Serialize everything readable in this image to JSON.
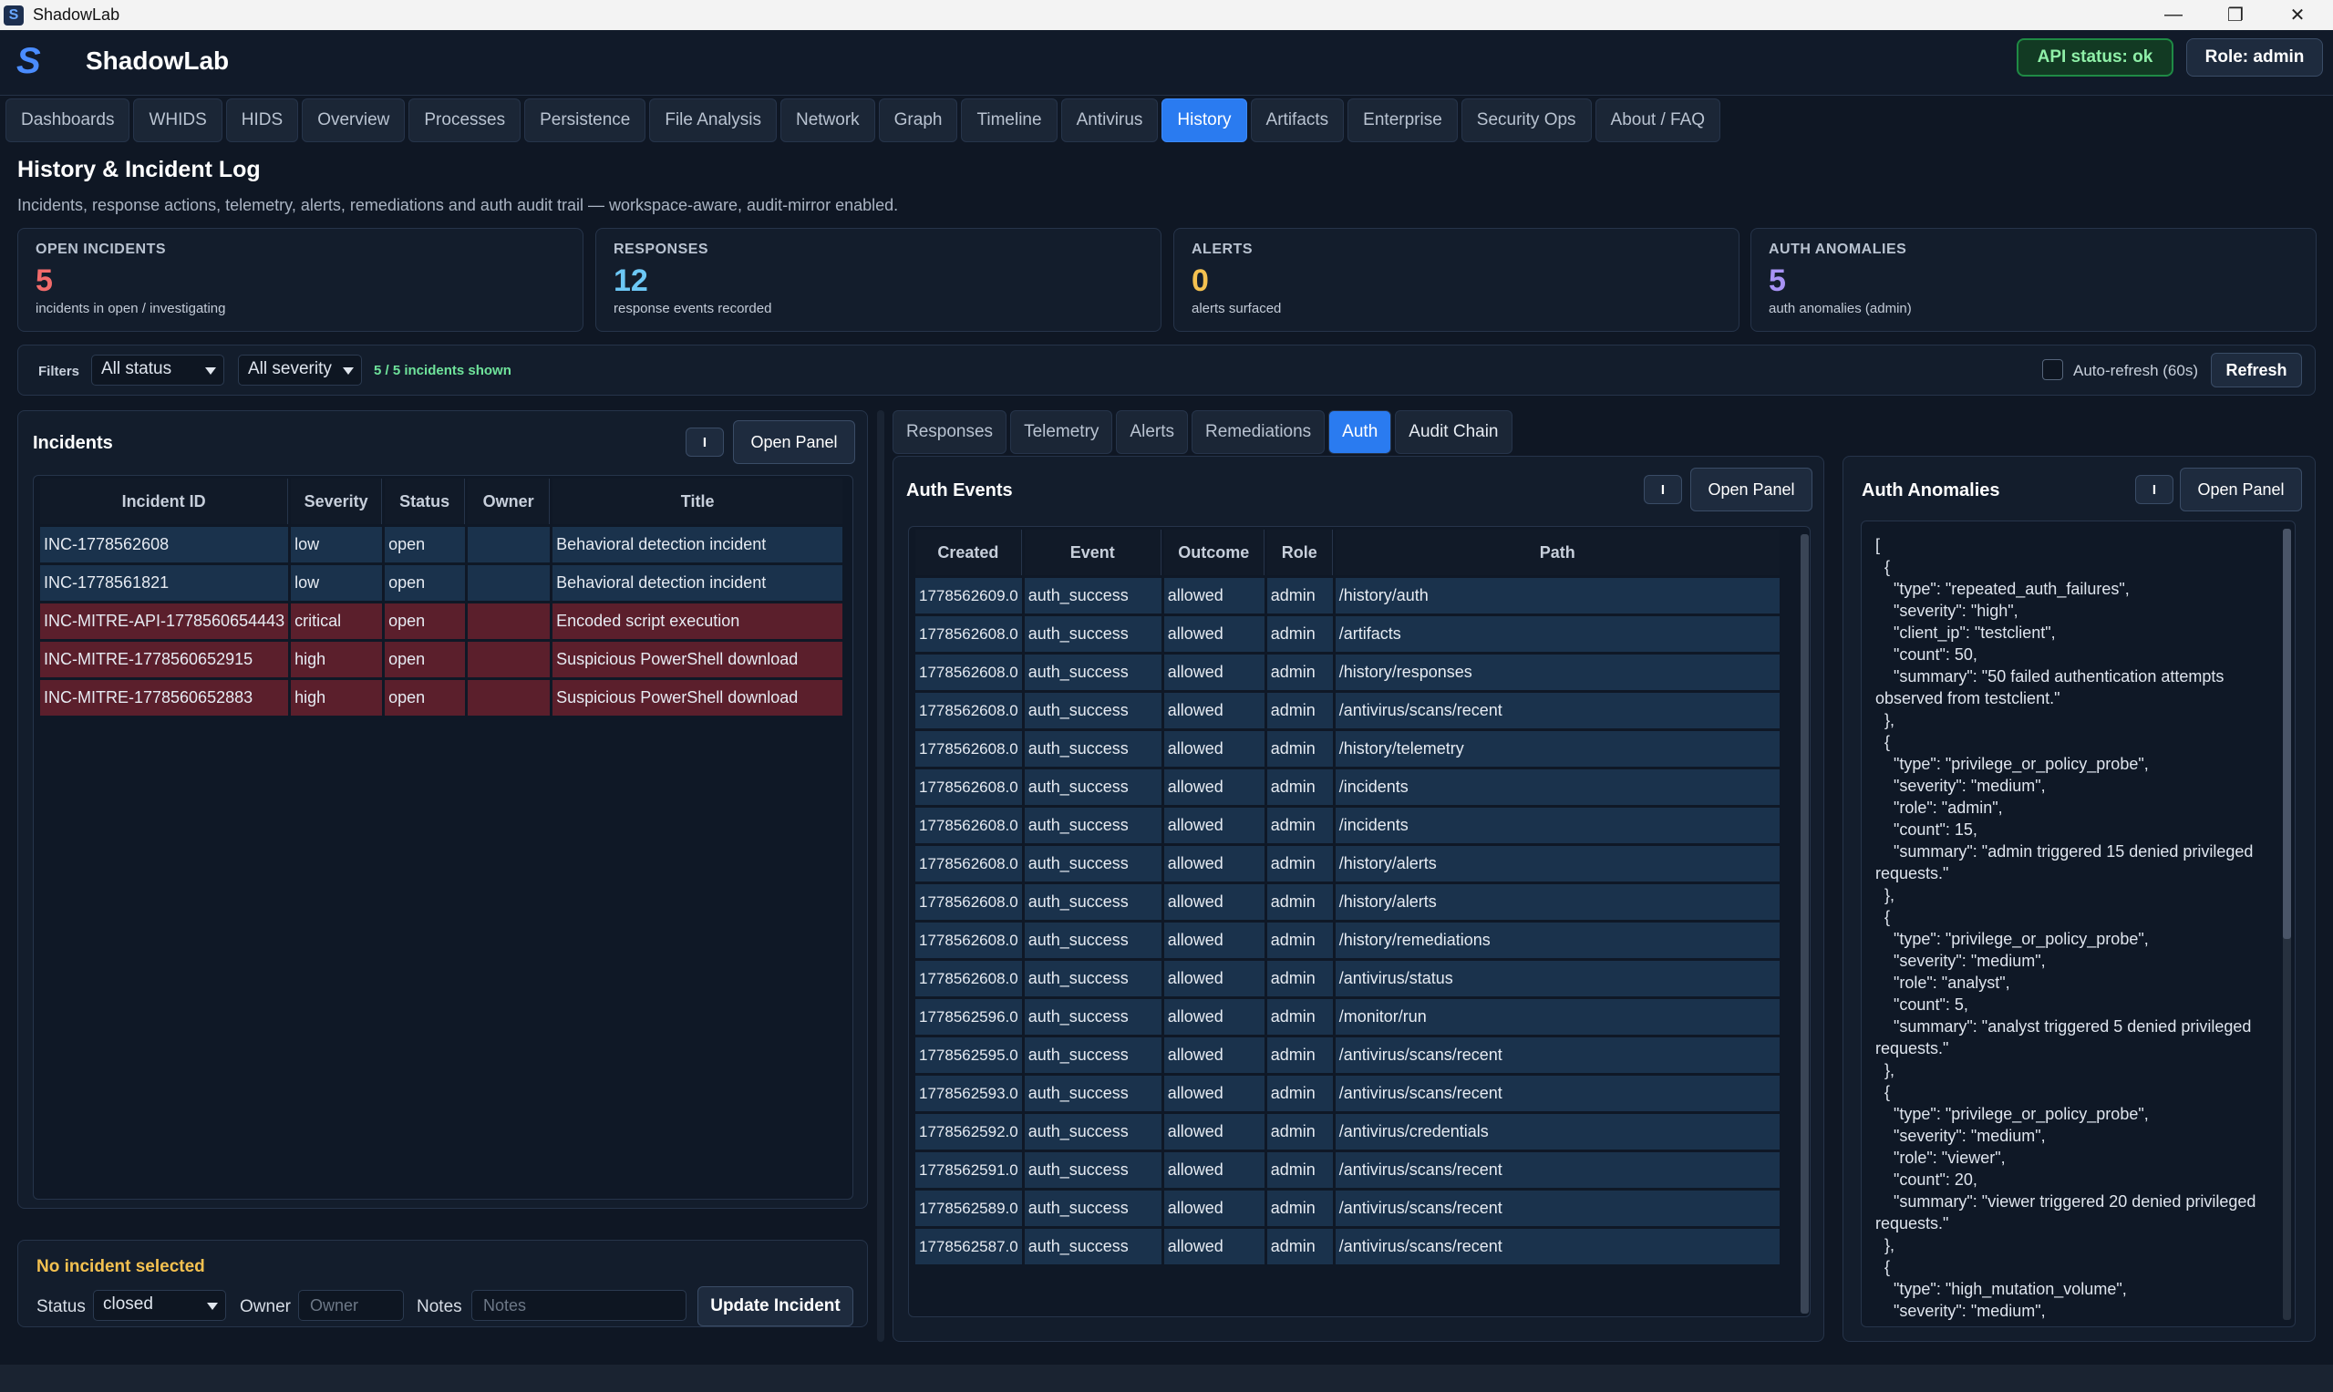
{
  "window": {
    "title": "ShadowLab"
  },
  "header": {
    "logo": "S",
    "brand": "ShadowLab",
    "api_status": "API status: ok",
    "role": "Role: admin"
  },
  "nav": {
    "tabs": [
      "Dashboards",
      "WHIDS",
      "HIDS",
      "Overview",
      "Processes",
      "Persistence",
      "File Analysis",
      "Network",
      "Graph",
      "Timeline",
      "Antivirus",
      "History",
      "Artifacts",
      "Enterprise",
      "Security Ops",
      "About / FAQ"
    ],
    "active": "History"
  },
  "page": {
    "title": "History & Incident Log",
    "subtitle": "Incidents, response actions, telemetry, alerts, remediations and auth audit trail — workspace-aware, audit-mirror enabled."
  },
  "stats": [
    {
      "label": "OPEN INCIDENTS",
      "value": "5",
      "desc": "incidents in open / investigating",
      "color": "#f26b6b"
    },
    {
      "label": "RESPONSES",
      "value": "12",
      "desc": "response events recorded",
      "color": "#6cc7f5"
    },
    {
      "label": "ALERTS",
      "value": "0",
      "desc": "alerts surfaced",
      "color": "#f4c150"
    },
    {
      "label": "AUTH ANOMALIES",
      "value": "5",
      "desc": "auth anomalies (admin)",
      "color": "#a893f5"
    }
  ],
  "filters": {
    "label": "Filters",
    "status": "All status",
    "severity": "All severity",
    "count": "5 / 5 incidents shown",
    "auto_refresh": "Auto-refresh (60s)",
    "refresh": "Refresh"
  },
  "incidents": {
    "title": "Incidents",
    "info_btn": "I",
    "open_panel": "Open Panel",
    "columns": [
      "Incident ID",
      "Severity",
      "Status",
      "Owner",
      "Title"
    ],
    "rows": [
      {
        "id": "INC-1778562608",
        "severity": "low",
        "status": "open",
        "owner": "",
        "title": "Behavioral detection incident",
        "hot": false
      },
      {
        "id": "INC-1778561821",
        "severity": "low",
        "status": "open",
        "owner": "",
        "title": "Behavioral detection incident",
        "hot": false
      },
      {
        "id": "INC-MITRE-API-1778560654443",
        "severity": "critical",
        "status": "open",
        "owner": "",
        "title": "Encoded script execution",
        "hot": true
      },
      {
        "id": "INC-MITRE-1778560652915",
        "severity": "high",
        "status": "open",
        "owner": "",
        "title": "Suspicious PowerShell download",
        "hot": true
      },
      {
        "id": "INC-MITRE-1778560652883",
        "severity": "high",
        "status": "open",
        "owner": "",
        "title": "Suspicious PowerShell download",
        "hot": true
      }
    ]
  },
  "incident_editor": {
    "none_selected": "No incident selected",
    "status_label": "Status",
    "status_value": "closed",
    "owner_label": "Owner",
    "owner_placeholder": "Owner",
    "notes_label": "Notes",
    "notes_placeholder": "Notes",
    "update": "Update Incident"
  },
  "subtabs": {
    "items": [
      "Responses",
      "Telemetry",
      "Alerts",
      "Remediations",
      "Auth",
      "Audit Chain"
    ],
    "active": "Auth"
  },
  "auth_events": {
    "title": "Auth Events",
    "info_btn": "I",
    "open_panel": "Open Panel",
    "columns": [
      "Created",
      "Event",
      "Outcome",
      "Role",
      "Path"
    ],
    "rows": [
      [
        "1778562609.0",
        "auth_success",
        "allowed",
        "admin",
        "/history/auth"
      ],
      [
        "1778562608.0",
        "auth_success",
        "allowed",
        "admin",
        "/artifacts"
      ],
      [
        "1778562608.0",
        "auth_success",
        "allowed",
        "admin",
        "/history/responses"
      ],
      [
        "1778562608.0",
        "auth_success",
        "allowed",
        "admin",
        "/antivirus/scans/recent"
      ],
      [
        "1778562608.0",
        "auth_success",
        "allowed",
        "admin",
        "/history/telemetry"
      ],
      [
        "1778562608.0",
        "auth_success",
        "allowed",
        "admin",
        "/incidents"
      ],
      [
        "1778562608.0",
        "auth_success",
        "allowed",
        "admin",
        "/incidents"
      ],
      [
        "1778562608.0",
        "auth_success",
        "allowed",
        "admin",
        "/history/alerts"
      ],
      [
        "1778562608.0",
        "auth_success",
        "allowed",
        "admin",
        "/history/alerts"
      ],
      [
        "1778562608.0",
        "auth_success",
        "allowed",
        "admin",
        "/history/remediations"
      ],
      [
        "1778562608.0",
        "auth_success",
        "allowed",
        "admin",
        "/antivirus/status"
      ],
      [
        "1778562596.0",
        "auth_success",
        "allowed",
        "admin",
        "/monitor/run"
      ],
      [
        "1778562595.0",
        "auth_success",
        "allowed",
        "admin",
        "/antivirus/scans/recent"
      ],
      [
        "1778562593.0",
        "auth_success",
        "allowed",
        "admin",
        "/antivirus/scans/recent"
      ],
      [
        "1778562592.0",
        "auth_success",
        "allowed",
        "admin",
        "/antivirus/credentials"
      ],
      [
        "1778562591.0",
        "auth_success",
        "allowed",
        "admin",
        "/antivirus/scans/recent"
      ],
      [
        "1778562589.0",
        "auth_success",
        "allowed",
        "admin",
        "/antivirus/scans/recent"
      ],
      [
        "1778562587.0",
        "auth_success",
        "allowed",
        "admin",
        "/antivirus/scans/recent"
      ]
    ]
  },
  "auth_anomalies": {
    "title": "Auth Anomalies",
    "info_btn": "I",
    "open_panel": "Open Panel",
    "json_text": "[\n  {\n    \"type\": \"repeated_auth_failures\",\n    \"severity\": \"high\",\n    \"client_ip\": \"testclient\",\n    \"count\": 50,\n    \"summary\": \"50 failed authentication attempts observed from testclient.\"\n  },\n  {\n    \"type\": \"privilege_or_policy_probe\",\n    \"severity\": \"medium\",\n    \"role\": \"admin\",\n    \"count\": 15,\n    \"summary\": \"admin triggered 15 denied privileged requests.\"\n  },\n  {\n    \"type\": \"privilege_or_policy_probe\",\n    \"severity\": \"medium\",\n    \"role\": \"analyst\",\n    \"count\": 5,\n    \"summary\": \"analyst triggered 5 denied privileged requests.\"\n  },\n  {\n    \"type\": \"privilege_or_policy_probe\",\n    \"severity\": \"medium\",\n    \"role\": \"viewer\",\n    \"count\": 20,\n    \"summary\": \"viewer triggered 20 denied privileged requests.\"\n  },\n  {\n    \"type\": \"high_mutation_volume\",\n    \"severity\": \"medium\","
  }
}
